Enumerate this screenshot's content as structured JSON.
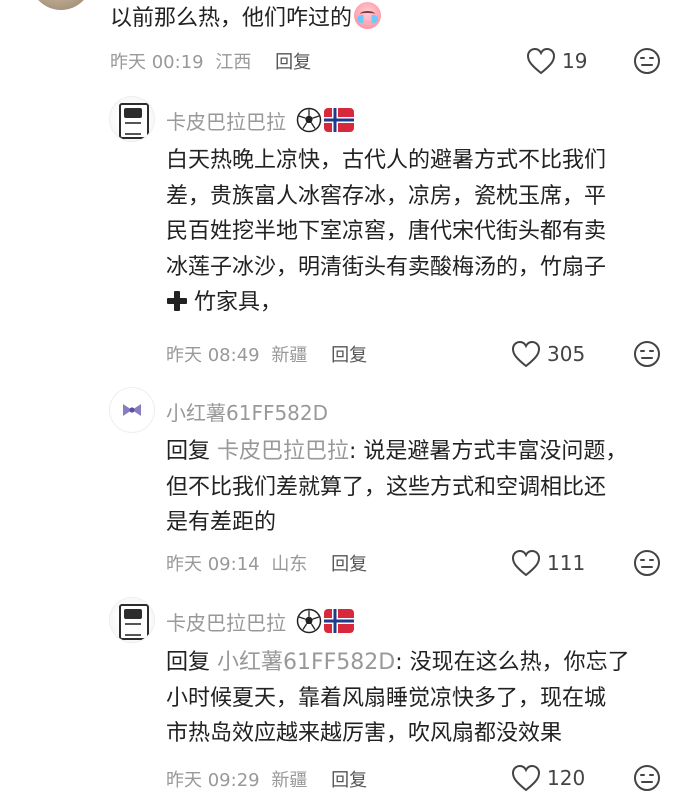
{
  "top_comment": {
    "text": "以前那么热，他们咋过的",
    "emoji_icon": "crying-face-icon",
    "time": "昨天 00:19",
    "location": "江西",
    "reply_label": "回复",
    "likes": "19"
  },
  "replies": [
    {
      "username": "卡皮巴拉巴拉",
      "badges": [
        "soccer-ball-icon",
        "norway-flag-icon"
      ],
      "lines": [
        "白天热晚上凉快，古代人的避暑方式不比我们",
        "差，贵族富人冰窖存冰，凉房，瓷枕玉席，平",
        "民百姓挖半地下室凉窖，唐代宋代街头都有卖",
        "冰莲子冰沙，明清街头有卖酸梅汤的，竹扇子",
        "竹家具，"
      ],
      "time": "昨天 08:49",
      "location": "新疆",
      "reply_label": "回复",
      "likes": "305"
    },
    {
      "username": "小红薯61FF582D",
      "reply_prefix": "回复 ",
      "reply_target": "卡皮巴拉巴拉",
      "first_line_rest": ": 说是避暑方式丰富没问题，",
      "lines": [
        "但不比我们差就算了，这些方式和空调相比还",
        "是有差距的"
      ],
      "time": "昨天 09:14",
      "location": "山东",
      "reply_label": "回复",
      "likes": "111"
    },
    {
      "username": "卡皮巴拉巴拉",
      "badges": [
        "soccer-ball-icon",
        "norway-flag-icon"
      ],
      "reply_prefix": "回复 ",
      "reply_target": "小红薯61FF582D",
      "first_line_rest": ": 没现在这么热，你忘了",
      "lines": [
        "小时候夏天，靠着风扇睡觉凉快多了，现在城",
        "市热岛效应越来越厉害，吹风扇都没效果"
      ],
      "time": "昨天 09:29",
      "location": "新疆",
      "reply_label": "回复",
      "likes": "120"
    }
  ],
  "colors": {
    "text_primary": "#222222",
    "text_secondary": "#999999",
    "icon": "#444444",
    "norway_red": "#D8283B",
    "norway_blue": "#1F3A8A"
  }
}
